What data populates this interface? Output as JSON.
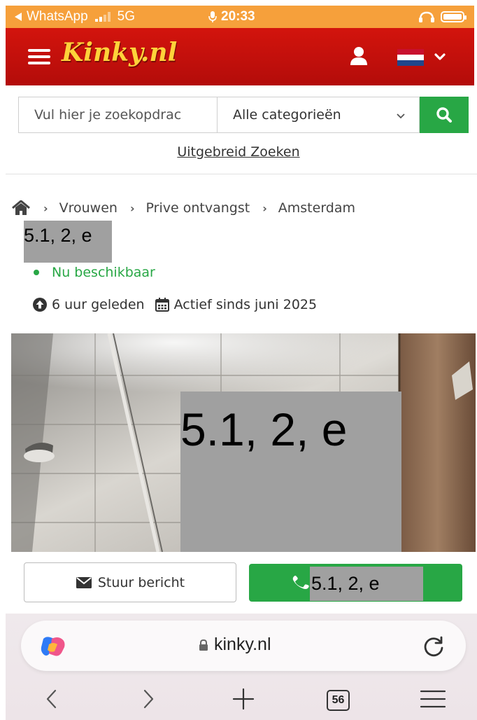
{
  "status_bar": {
    "back_app": "WhatsApp",
    "network": "5G",
    "time": "20:33"
  },
  "header": {
    "logo": "Kinky.nl"
  },
  "search": {
    "placeholder": "Vul hier je zoekopdrac",
    "category": "Alle categorieën",
    "advanced_link": "Uitgebreid Zoeken"
  },
  "breadcrumb": [
    "Vrouwen",
    "Prive ontvangst",
    "Amsterdam"
  ],
  "listing": {
    "title_redacted": "5.1, 2, e",
    "availability": "Nu beschikbaar",
    "posted": "6 uur geleden",
    "active_since": "Actief sinds juni 2025",
    "photo_redacted": "5.1, 2, e",
    "phone_redacted": "5.1, 2, e"
  },
  "actions": {
    "message_label": "Stuur bericht"
  },
  "browser": {
    "url": "kinky.nl",
    "tab_count": "56"
  },
  "colors": {
    "status_bar": "#f6a03b",
    "header_red": "#c4110b",
    "logo_yellow": "#ffd23a",
    "accent_green": "#28a745",
    "redaction_gray": "#a0a0a0"
  }
}
